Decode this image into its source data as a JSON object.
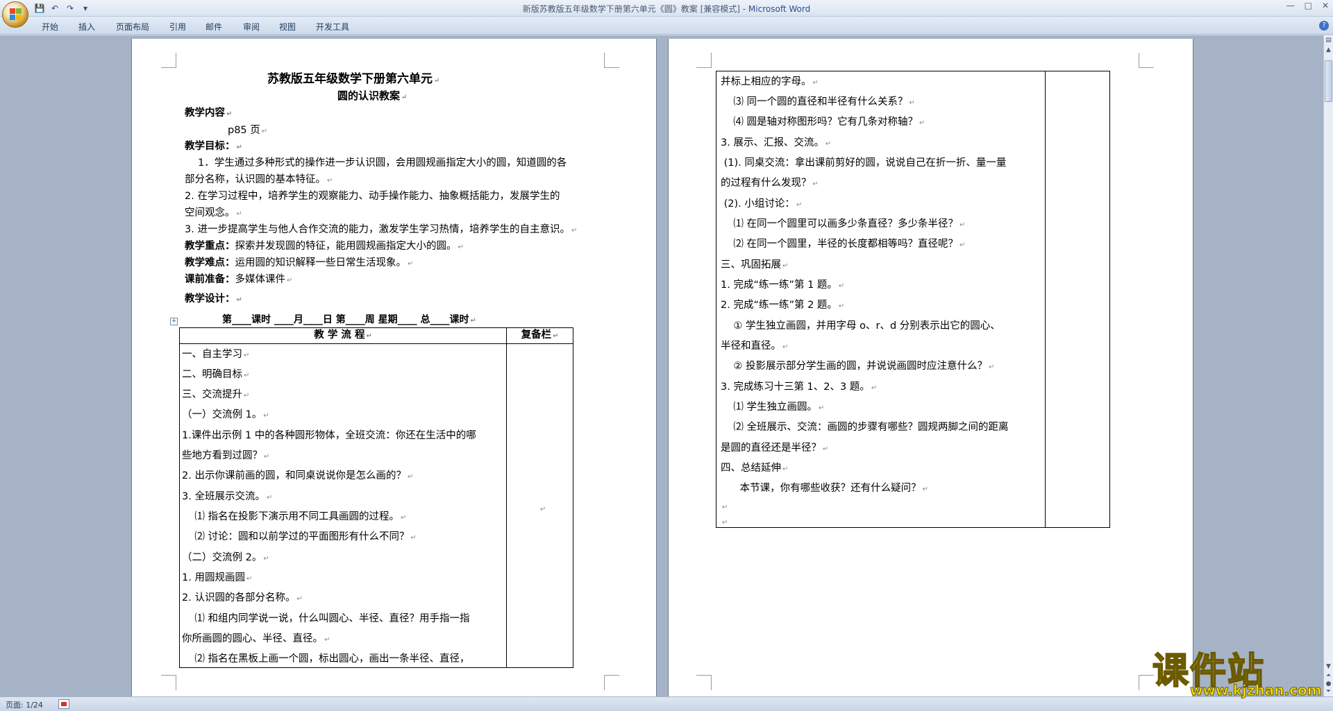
{
  "window": {
    "title_main": "新版苏教版五年级数学下册第六单元《圆》教案 [兼容模式] - ",
    "title_app": "Microsoft Word",
    "min_glyph": "—",
    "max_glyph": "□",
    "close_glyph": "✕"
  },
  "qat": {
    "save": "💾",
    "undo": "↶",
    "redo": "↷",
    "more": "▾"
  },
  "ribbon": {
    "tabs": [
      "开始",
      "插入",
      "页面布局",
      "引用",
      "邮件",
      "审阅",
      "视图",
      "开发工具"
    ],
    "help": "?"
  },
  "page1": {
    "title": "苏教版五年级数学下册第六单元",
    "subtitle": "圆的认识教案",
    "content_label": "教学内容",
    "content_value": "p85 页",
    "goals_label": "教学目标：",
    "goal1_a": "1．学生通过多种形式的操作进一步认识圆，会用圆规画指定大小的圆，知道圆的各",
    "goal1_b": "部分名称，认识圆的基本特征。",
    "goal2_a": "2.   在学习过程中，培养学生的观察能力、动手操作能力、抽象概括能力，发展学生的",
    "goal2_b": "空间观念。",
    "goal3": "3. 进一步提高学生与他人合作交流的能力，激发学生学习热情，培养学生的自主意识。",
    "key_label": "教学重点：",
    "key_value": "探索并发现圆的特征，能用圆规画指定大小的圆。",
    "diff_label": "教学难点：",
    "diff_value": "运用圆的知识解释一些日常生活现象。",
    "prep_label": "课前准备：",
    "prep_value": "多媒体课件",
    "design_label": "教学设计：",
    "schedule": "第____课时    ____月____日    第____周    星期____      总____课时",
    "flow_header": "教 学 流 程",
    "notes_header": "复备栏",
    "flow_lines": [
      "一、自主学习",
      "二、明确目标",
      "三、交流提升",
      "（一）交流例 1。",
      "1.课件出示例 1 中的各种圆形物体，全班交流：你还在生活中的哪",
      "些地方看到过圆？",
      "2. 出示你课前画的圆，和同桌说说你是怎么画的？",
      "3. 全班展示交流。",
      "    ⑴ 指名在投影下演示用不同工具画圆的过程。",
      "    ⑵ 讨论：圆和以前学过的平面图形有什么不同？",
      "（二）交流例 2。",
      "1. 用圆规画圆",
      "2. 认识圆的各部分名称。",
      "    ⑴ 和组内同学说一说，什么叫圆心、半径、直径？用手指一指",
      "你所画圆的圆心、半径、直径。",
      "    ⑵ 指名在黑板上画一个圆，标出圆心，画出一条半径、直径，"
    ]
  },
  "page2": {
    "flow_lines": [
      "并标上相应的字母。",
      "    ⑶ 同一个圆的直径和半径有什么关系？",
      "    ⑷ 圆是轴对称图形吗？它有几条对称轴？",
      "3. 展示、汇报、交流。",
      " (1). 同桌交流：拿出课前剪好的圆，说说自己在折一折、量一量",
      "的过程有什么发现？",
      " (2). 小组讨论：",
      "    ⑴ 在同一个圆里可以画多少条直径？多少条半径？",
      "    ⑵ 在同一个圆里，半径的长度都相等吗？直径呢？",
      "三、巩固拓展",
      "1. 完成“练一练”第 1 题。",
      "2. 完成“练一练”第 2 题。",
      "    ① 学生独立画圆，并用字母 o、r、d 分别表示出它的圆心、",
      "半径和直径。",
      "    ② 投影展示部分学生画的圆，并说说画圆时应注意什么？",
      "3. 完成练习十三第 1、2、3 题。",
      "    ⑴ 学生独立画圆。",
      "    ⑵ 全班展示、交流：画圆的步骤有哪些？圆规两脚之间的距离",
      "是圆的直径还是半径？",
      "四、总结延伸",
      "      本节课，你有哪些收获？还有什么疑问？",
      "",
      ""
    ]
  },
  "status": {
    "page": "页面: 1/24"
  },
  "watermark": {
    "main": "课件站",
    "url": "www.kjzhan.com"
  },
  "colors": {
    "doc_bg": "#a6b3c6",
    "ribbon": "#dbe5f1",
    "watermark": "#f5e100"
  }
}
